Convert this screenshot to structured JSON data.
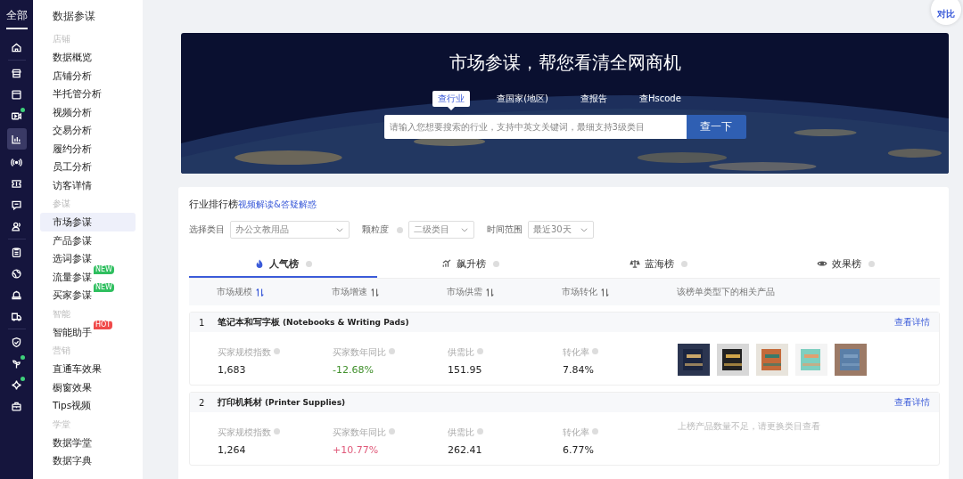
{
  "rail": {
    "label": "全部",
    "items": [
      {
        "selected": false,
        "dot": false
      },
      {
        "selected": false,
        "dot": false
      },
      {
        "selected": false,
        "dot": false
      },
      {
        "selected": false,
        "dot": true
      },
      {
        "selected": true,
        "dot": false
      },
      {
        "selected": false,
        "dot": false
      },
      {
        "selected": false,
        "dot": false
      },
      {
        "selected": false,
        "dot": false
      },
      {
        "selected": false,
        "dot": false
      },
      {
        "selected": false,
        "dot": false
      },
      {
        "selected": false,
        "dot": false
      },
      {
        "selected": false,
        "dot": false
      },
      {
        "selected": false,
        "dot": false
      },
      {
        "selected": false,
        "dot": false
      },
      {
        "selected": false,
        "dot": true
      },
      {
        "selected": false,
        "dot": true
      },
      {
        "selected": false,
        "dot": false
      }
    ]
  },
  "sidebar": {
    "title": "数据参谋",
    "groups": [
      {
        "heading": "店铺",
        "items": [
          {
            "label": "数据概览",
            "selected": false
          },
          {
            "label": "店铺分析",
            "selected": false
          },
          {
            "label": "半托管分析",
            "selected": false
          },
          {
            "label": "视频分析",
            "selected": false
          },
          {
            "label": "交易分析",
            "selected": false
          },
          {
            "label": "履约分析",
            "selected": false
          },
          {
            "label": "员工分析",
            "selected": false
          },
          {
            "label": "访客详情",
            "selected": false
          }
        ]
      },
      {
        "heading": "参谋",
        "items": [
          {
            "label": "市场参谋",
            "selected": true
          },
          {
            "label": "产品参谋",
            "selected": false
          },
          {
            "label": "选词参谋",
            "selected": false
          },
          {
            "label": "流量参谋",
            "selected": false,
            "badge": "NEW",
            "color": "#2fbf5f"
          },
          {
            "label": "买家参谋",
            "selected": false,
            "badge": "NEW",
            "color": "#2fbf5f"
          }
        ]
      },
      {
        "heading": "智能",
        "items": [
          {
            "label": "智能助手",
            "selected": false,
            "badge": "HOT",
            "color": "#f04a4a"
          }
        ]
      },
      {
        "heading": "营销",
        "items": [
          {
            "label": "直通车效果",
            "selected": false
          },
          {
            "label": "橱窗效果",
            "selected": false
          },
          {
            "label": "Tips视频",
            "selected": false
          }
        ]
      },
      {
        "heading": "学堂",
        "items": [
          {
            "label": "数据学堂",
            "selected": false
          },
          {
            "label": "数据字典",
            "selected": false
          }
        ]
      }
    ]
  },
  "compare_button": "对比",
  "banner": {
    "title": "市场参谋，帮您看清全网商机",
    "tabs": [
      {
        "label": "查行业",
        "selected": true
      },
      {
        "label": "查国家(地区)",
        "selected": false
      },
      {
        "label": "查报告",
        "selected": false
      },
      {
        "label": "查Hscode",
        "selected": false
      }
    ],
    "search": {
      "placeholder": "请输入您想要搜索的行业，支持中英文关键词，最细支持3级类目"
    },
    "button": "查一下"
  },
  "ranking": {
    "title": "行业排行榜",
    "link": "视频解读&答疑解惑",
    "filters": [
      {
        "label": "选择类目",
        "info": false,
        "value": "办公文教用品"
      },
      {
        "label": "颗粒度",
        "info": true,
        "value": "二级类目"
      },
      {
        "label": "时间范围",
        "info": false,
        "value": "最近30天"
      }
    ],
    "tabs": [
      {
        "label": "人气榜",
        "selected": true
      },
      {
        "label": "飙升榜",
        "selected": false
      },
      {
        "label": "蓝海榜",
        "selected": false
      },
      {
        "label": "效果榜",
        "selected": false
      }
    ],
    "columns": [
      {
        "label": "市场规模",
        "sortable": true,
        "sorted": true
      },
      {
        "label": "市场增速",
        "sortable": true,
        "sorted": false
      },
      {
        "label": "市场供需",
        "sortable": true,
        "sorted": false
      },
      {
        "label": "市场转化",
        "sortable": true,
        "sorted": false
      },
      {
        "label": "该榜单类型下的相关产品",
        "sortable": false,
        "sorted": false
      }
    ],
    "rows": [
      {
        "rank": "1",
        "name": "笔记本和写字板",
        "name_en": "(Notebooks & Writing Pads)",
        "link": "查看详情",
        "metrics": [
          {
            "label": "买家规模指数",
            "value": "1,683"
          },
          {
            "label": "买家数年同比",
            "value": "-12.68%",
            "color": "#3f8f2a"
          },
          {
            "label": "供需比",
            "value": "151.95"
          },
          {
            "label": "转化率",
            "value": "7.84%"
          }
        ],
        "products": [
          {
            "kind": "picture"
          },
          {
            "kind": "picture"
          },
          {
            "kind": "picture"
          },
          {
            "kind": "picture"
          },
          {
            "kind": "picture"
          }
        ]
      },
      {
        "rank": "2",
        "name": "打印机耗材",
        "name_en": "(Printer Supplies)",
        "link": "查看详情",
        "metrics": [
          {
            "label": "买家规模指数",
            "value": "1,264"
          },
          {
            "label": "买家数年同比",
            "value": "+10.77%",
            "color": "#e05a7a"
          },
          {
            "label": "供需比",
            "value": "262.41"
          },
          {
            "label": "转化率",
            "value": "6.77%"
          }
        ],
        "note": "上榜产品数量不足，请更换类目查看"
      }
    ]
  }
}
